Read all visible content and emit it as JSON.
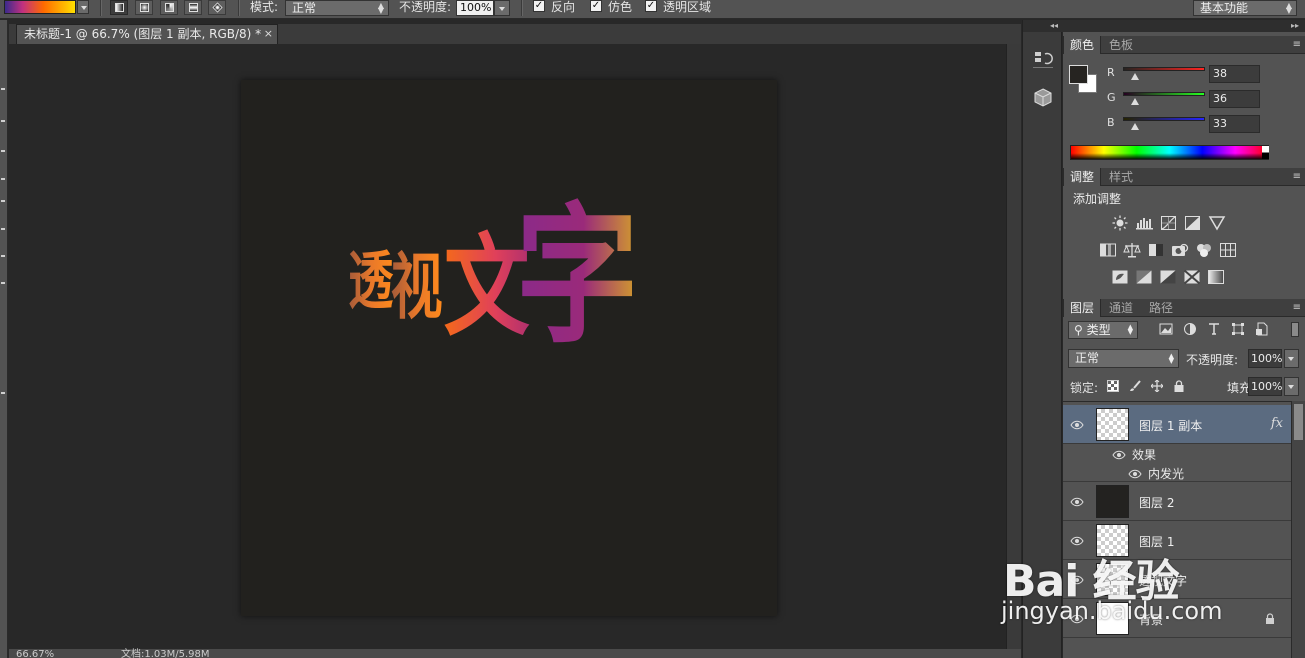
{
  "options_bar": {
    "mode_label": "模式:",
    "mode_value": "正常",
    "opacity_label": "不透明度:",
    "opacity_value": "100%",
    "reverse_label": "反向",
    "dither_label": "仿色",
    "transparency_label": "透明区域",
    "reverse_checked": true,
    "dither_checked": true,
    "transparency_checked": true,
    "workspace": "基本功能",
    "gradient_types": [
      "linear",
      "radial",
      "angle",
      "reflected",
      "diamond"
    ]
  },
  "document": {
    "tab_title": "未标题-1 @ 66.7% (图层 1 副本, RGB/8) *",
    "tab_close": "×",
    "canvas_text": "透视文字",
    "zoom": "66.67%",
    "doc_size": "文档:1.03M/5.98M"
  },
  "color_panel": {
    "tabs": [
      "颜色",
      "色板"
    ],
    "active_tab": "颜色",
    "r_label": "R",
    "g_label": "G",
    "b_label": "B",
    "r": 38,
    "g": 36,
    "b": 33,
    "foreground": "#262421",
    "background": "#ffffff"
  },
  "adjustments_panel": {
    "tabs": [
      "调整",
      "样式"
    ],
    "title": "添加调整",
    "icons": [
      [
        "brightness-contrast-icon",
        "levels-icon",
        "curves-icon",
        "exposure-icon",
        "vibrance-icon"
      ],
      [
        "hue-saturation-icon",
        "color-balance-icon",
        "black-white-icon",
        "photo-filter-icon",
        "channel-mixer-icon",
        "color-lookup-icon"
      ],
      [
        "invert-icon",
        "posterize-icon",
        "threshold-icon",
        "selective-color-icon",
        "gradient-map-icon"
      ]
    ]
  },
  "layers_panel": {
    "tabs": [
      "图层",
      "通道",
      "路径"
    ],
    "filter_label": "类型",
    "blend_mode": "正常",
    "opacity_label": "不透明度:",
    "opacity": "100%",
    "lock_label": "锁定:",
    "fill_label": "填充:",
    "fill": "100%",
    "layers": [
      {
        "name": "图层 1 副本",
        "selected": true,
        "thumb": "checker",
        "fx": "fx"
      },
      {
        "name": "图层 2",
        "selected": false,
        "thumb": "dark",
        "fx": ""
      },
      {
        "name": "图层 1",
        "selected": false,
        "thumb": "checker",
        "fx": ""
      },
      {
        "name": "透视文字",
        "selected": false,
        "thumb": "checker",
        "fx": ""
      },
      {
        "name": "背景",
        "selected": false,
        "thumb": "white",
        "fx": ""
      }
    ],
    "effects_label": "效果",
    "inner_glow_label": "内发光"
  },
  "watermark": {
    "brand": "Bai 经验",
    "url": "jingyan.baidu.com"
  },
  "colors": {
    "ui_dark": "#282828",
    "panel": "#535353",
    "selected_layer": "#5b6b80"
  }
}
